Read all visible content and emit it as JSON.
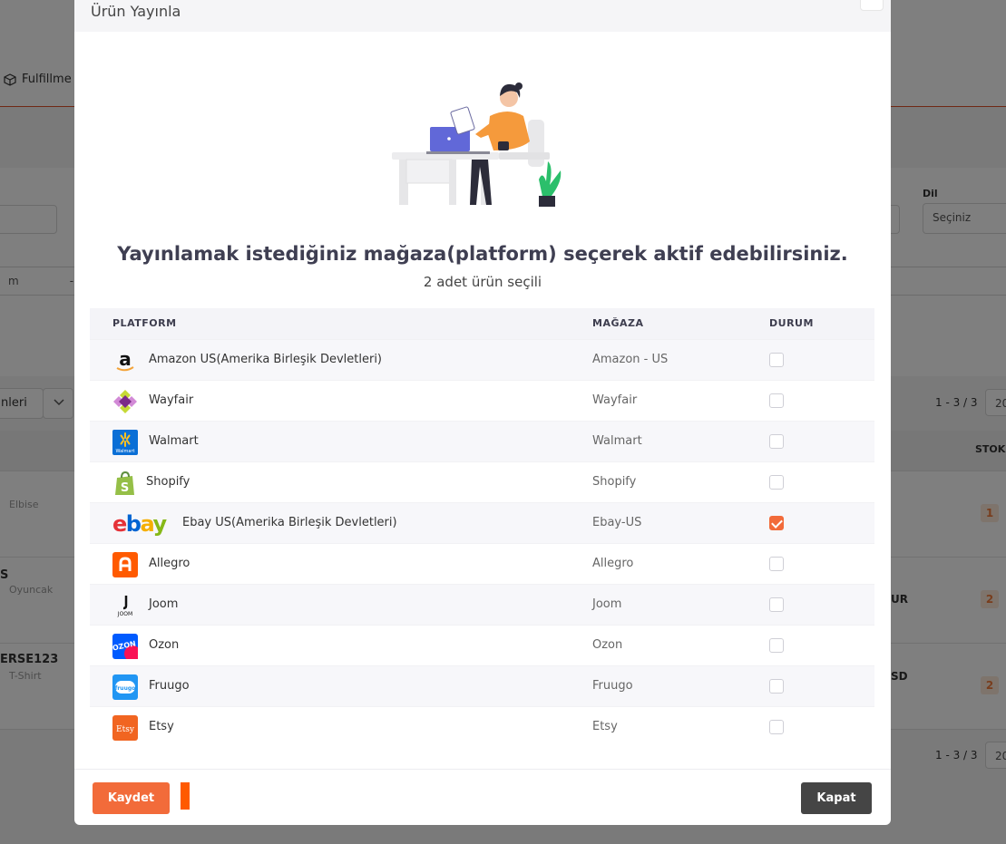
{
  "background": {
    "nav_item_label": "Fulfillme",
    "dil_label": "Dil",
    "dil_placeholder": "Seçiniz",
    "partial_field_text": "m",
    "dash_text": "-",
    "actions_label": "nleri",
    "pagination_text": "1 - 3 / 3",
    "page_size": "20",
    "stock_header": "STOK",
    "rows": [
      {
        "code": "",
        "category": "Elbise",
        "stock": "1",
        "extra": ""
      },
      {
        "code": "S",
        "category": "Oyuncak",
        "stock": "2",
        "extra": "UR"
      },
      {
        "code": "ERSE123",
        "category": "T-Shirt",
        "stock": "2",
        "extra": "SD"
      }
    ]
  },
  "modal": {
    "title": "Ürün Yayınla",
    "headline": "Yayınlamak istediğiniz mağaza(platform) seçerek aktif edebilirsiniz.",
    "subline": "2 adet ürün seçili",
    "columns": {
      "platform": "PLATFORM",
      "store": "MAĞAZA",
      "status": "DURUM"
    },
    "platforms": [
      {
        "name": "Amazon US(Amerika Birleşik Devletleri)",
        "store": "Amazon - US",
        "checked": false,
        "icon": "amazon-logo-icon"
      },
      {
        "name": "Wayfair",
        "store": "Wayfair",
        "checked": false,
        "icon": "wayfair-logo-icon"
      },
      {
        "name": "Walmart",
        "store": "Walmart",
        "checked": false,
        "icon": "walmart-logo-icon",
        "logo_text": "Walmart"
      },
      {
        "name": "Shopify",
        "store": "Shopify",
        "checked": false,
        "icon": "shopify-logo-icon"
      },
      {
        "name": "Ebay US(Amerika Birleşik Devletleri)",
        "store": "Ebay-US",
        "checked": true,
        "icon": "ebay-logo-icon",
        "logo_text": "ebay"
      },
      {
        "name": "Allegro",
        "store": "Allegro",
        "checked": false,
        "icon": "allegro-logo-icon"
      },
      {
        "name": "Joom",
        "store": "Joom",
        "checked": false,
        "icon": "joom-logo-icon",
        "logo_text": "JOOM"
      },
      {
        "name": "Ozon",
        "store": "Ozon",
        "checked": false,
        "icon": "ozon-logo-icon",
        "logo_text": "OZON"
      },
      {
        "name": "Fruugo",
        "store": "Fruugo",
        "checked": false,
        "icon": "fruugo-logo-icon",
        "logo_text": "fruugo"
      },
      {
        "name": "Etsy",
        "store": "Etsy",
        "checked": false,
        "icon": "etsy-logo-icon",
        "logo_text": "Etsy"
      }
    ],
    "save_label": "Kaydet",
    "close_label": "Kapat"
  },
  "colors": {
    "accent": "#f26b3a",
    "dark_button": "#454545",
    "header_bg": "#f4f4f8"
  }
}
